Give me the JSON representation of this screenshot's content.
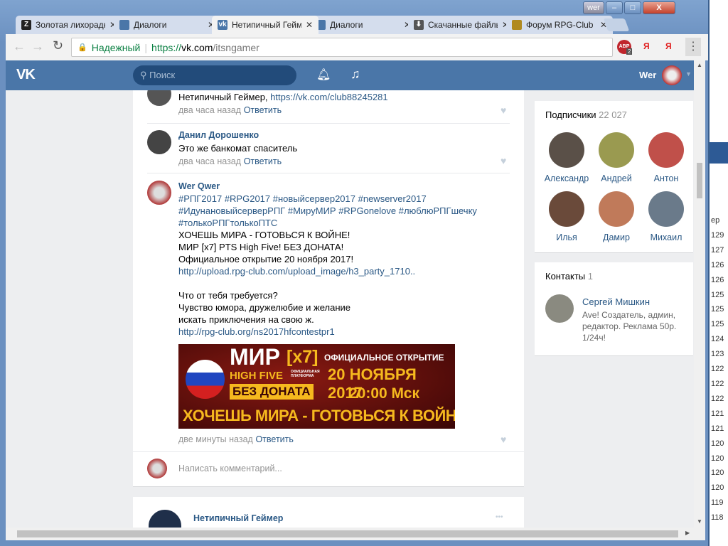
{
  "background_window": {
    "header": "ep",
    "values": [
      "129",
      "127",
      "126",
      "126",
      "125",
      "125",
      "125",
      "124",
      "123",
      "122",
      "122",
      "122",
      "121",
      "121",
      "120",
      "120",
      "120",
      "120",
      "119",
      "118"
    ]
  },
  "window": {
    "user_label": "wer",
    "minimize": "‒",
    "maximize": "□",
    "close": "X"
  },
  "tabs": [
    {
      "label": "Золотая лихорадка",
      "icon": "Z",
      "color": "#222"
    },
    {
      "label": "Диалоги",
      "icon": "",
      "color": "#4a76a8"
    },
    {
      "label": "Нетипичный Геймер",
      "icon": "vk",
      "color": "#4a76a8",
      "active": true
    },
    {
      "label": "Диалоги",
      "icon": "",
      "color": "#4a76a8"
    },
    {
      "label": "Скачанные файлы",
      "icon": "⬇",
      "color": "#555"
    },
    {
      "label": "Форум RPG-Club",
      "icon": "",
      "color": "#b08a20"
    }
  ],
  "toolbar": {
    "secure_label": "Надежный",
    "url_scheme": "https://",
    "url_host": "vk.com",
    "url_path": "/itsngamer",
    "abp_badge": "ABP",
    "abp_count": "2",
    "ya1": "Я",
    "ya2": "Я"
  },
  "vk_header": {
    "logo": "VK",
    "search_placeholder": "Поиск",
    "user_name": "Wer"
  },
  "comments": [
    {
      "author": "",
      "text": "Нетипичный Геймер, ",
      "link": "https://vk.com/club88245281",
      "time": "два часа назад",
      "reply": "Ответить"
    },
    {
      "author": "Данил Дорошенко",
      "text": "Это же банкомат спаситель",
      "time": "два часа назад",
      "reply": "Ответить"
    },
    {
      "author": "Wer Qwer",
      "hashtags": [
        "#РПГ2017 #RPG2017 #новыйсервер2017 #newserver2017",
        "#ИдунановыйсерверРПГ #МируМИР #RPGonelove #люблюРПГшечку",
        "#толькоРПГтолькоПТС"
      ],
      "lines": [
        "ХОЧЕШЬ МИРА - ГОТОВЬСЯ К ВОЙНЕ!",
        "МИР [x7] PTS High Five! БЕЗ ДОНАТА!",
        "Официальное открытие 20 ноября 2017!"
      ],
      "link1": "http://upload.rpg-club.com/upload_image/h3_party_1710..",
      "lines2": [
        "Что от тебя требуется?",
        "Чувство юмора, дружелюбие и желание",
        "искать приключения на свою ж."
      ],
      "link2": "http://rpg-club.org/ns2017hfcontestpr1",
      "banner": {
        "title": "МИР",
        "x7": "[x7]",
        "hf": "HIGH FIVE",
        "platform": "ОФИЦИАЛЬНАЯ ПЛАТФОРМА",
        "no_donate": "БЕЗ ДОНАТА",
        "opening": "ОФИЦИАЛЬНОЕ ОТКРЫТИЕ",
        "date": "20 НОЯБРЯ 2017",
        "time": "20:00 Мск",
        "slogan": "ХОЧЕШЬ МИРА - ГОТОВЬСЯ К ВОЙНЕ"
      },
      "time": "две минуты назад",
      "reply": "Ответить"
    }
  ],
  "comment_input": {
    "placeholder": "Написать комментарий..."
  },
  "next_post": {
    "author": "Нетипичный Геймер",
    "more": "•••"
  },
  "followers": {
    "title": "Подписчики",
    "count": "22 027",
    "items": [
      {
        "name": "Александр",
        "color": "#5a5048"
      },
      {
        "name": "Андрей",
        "color": "#9a9a50"
      },
      {
        "name": "Антон",
        "color": "#c0504a"
      },
      {
        "name": "Илья",
        "color": "#6a4a3a"
      },
      {
        "name": "Дамир",
        "color": "#c07a5a"
      },
      {
        "name": "Михаил",
        "color": "#6a7a8a"
      }
    ]
  },
  "contacts": {
    "title": "Контакты",
    "count": "1",
    "name": "Сергей Мишкин",
    "desc": "Ave! Создатель, админ, редактор. Реклама 50р. 1/24ч!"
  }
}
